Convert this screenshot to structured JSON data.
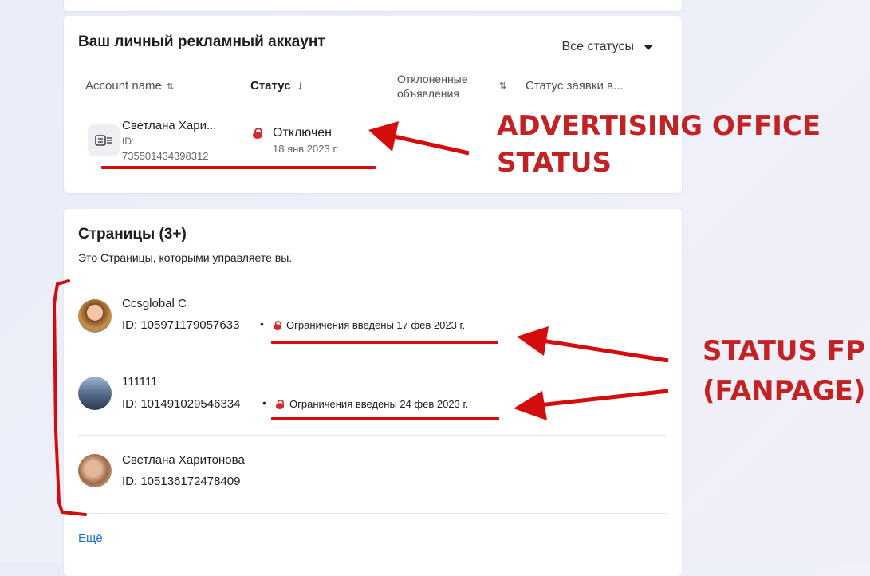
{
  "account_card": {
    "title": "Ваш личный рекламный аккаунт",
    "filter_label": "Все статусы",
    "columns": {
      "account_name": "Account name",
      "status": "Статус",
      "rejected_ads_line1": "Отклоненные",
      "rejected_ads_line2": "объявления",
      "request_status": "Статус заявки в..."
    },
    "row": {
      "name": "Светлана Хари...",
      "id_label": "ID:",
      "id_value": "735501434398312",
      "status": "Отключен",
      "status_date": "18 янв 2023 г."
    }
  },
  "pages_card": {
    "title": "Страницы (3+)",
    "subtitle": "Это Страницы, которыми управляете вы.",
    "pages": [
      {
        "name": "Ccsglobal C",
        "id": "ID: 105971179057633",
        "restriction": "Ограничения введены 17 фев 2023 г."
      },
      {
        "name": "111111",
        "id": "ID: 101491029546334",
        "restriction": "Ограничения введены 24 фев 2023 г."
      },
      {
        "name": "Светлана Харитонова",
        "id": "ID: 105136172478409",
        "restriction": ""
      }
    ],
    "more_link": "Ещё"
  },
  "annotations": {
    "ad_office_line1": "ADVERTISING OFFICE",
    "ad_office_line2": "STATUS",
    "fp_line1": "STATUS FP",
    "fp_line2": "(FANPAGE)"
  },
  "colors": {
    "annotation": "#c32222",
    "lock": "#d32a2a",
    "link": "#216fdb"
  }
}
